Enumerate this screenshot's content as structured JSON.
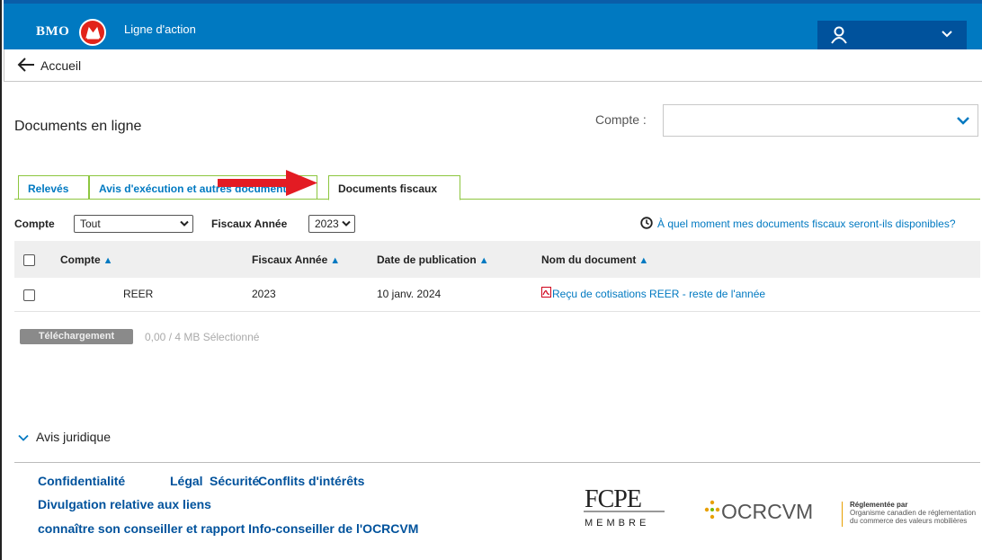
{
  "header": {
    "brand": "BMO",
    "product": "Ligne d'action",
    "colors": {
      "primary": "#0079c1",
      "dark": "#00529c",
      "brand_red": "#e2231a",
      "tab_border": "#8dc63f"
    }
  },
  "nav": {
    "back_label": "Accueil"
  },
  "page": {
    "title": "Documents en ligne",
    "compte_label": "Compte :",
    "compte_value": ""
  },
  "tabs": [
    {
      "label": "Relevés",
      "active": false
    },
    {
      "label": "Avis d'exécution et autres documents",
      "active": false
    },
    {
      "label": "Documents fiscaux",
      "active": true
    }
  ],
  "filters": {
    "compte_label": "Compte",
    "compte_value": "Tout",
    "annee_label": "Fiscaux Année",
    "annee_value": "2023",
    "info_link": "À quel moment mes documents fiscaux seront-ils disponibles?"
  },
  "table": {
    "headers": [
      "Compte",
      "Fiscaux Année",
      "Date de publication",
      "Nom du document"
    ],
    "rows": [
      {
        "compte": "REER",
        "annee": "2023",
        "date": "10 janv. 2024",
        "document": "Reçu de cotisations REER - reste de l'année"
      }
    ]
  },
  "download": {
    "button_label": "Téléchargement",
    "size_text": "0,00 / 4 MB Sélectionné"
  },
  "legal": {
    "label": "Avis juridique"
  },
  "footer": {
    "links_row1": [
      "Confidentialité",
      "Légal",
      "Sécurité",
      "Conflits d'intérêts"
    ],
    "link2": "Divulgation relative aux liens",
    "link3": "connaître son conseiller et rapport Info-conseiller de l'OCRCVM",
    "fcpe": "FCPE",
    "fcpe_sub": "MEMBRE",
    "ocrcvm": "OCRCVM",
    "ocr_reg_title": "Réglementée par",
    "ocr_reg_line1": "Organisme canadien de réglementation",
    "ocr_reg_line2": "du commerce des valeurs mobilières"
  }
}
